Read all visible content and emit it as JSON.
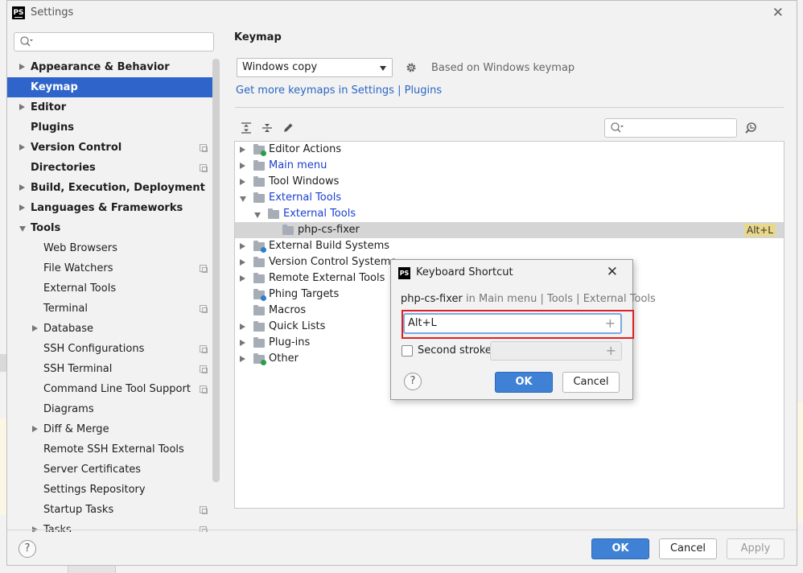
{
  "window": {
    "title": "Settings",
    "logo": "PS"
  },
  "sidebar": {
    "search_placeholder": "",
    "items": [
      {
        "label": "Appearance & Behavior",
        "level": 0,
        "bold": true,
        "arrow": "right",
        "copy": false,
        "selected": false
      },
      {
        "label": "Keymap",
        "level": 0,
        "bold": true,
        "arrow": "",
        "copy": false,
        "selected": true
      },
      {
        "label": "Editor",
        "level": 0,
        "bold": true,
        "arrow": "right",
        "copy": false,
        "selected": false
      },
      {
        "label": "Plugins",
        "level": 0,
        "bold": true,
        "arrow": "",
        "copy": false,
        "selected": false
      },
      {
        "label": "Version Control",
        "level": 0,
        "bold": true,
        "arrow": "right",
        "copy": true,
        "selected": false
      },
      {
        "label": "Directories",
        "level": 0,
        "bold": true,
        "arrow": "",
        "copy": true,
        "selected": false
      },
      {
        "label": "Build, Execution, Deployment",
        "level": 0,
        "bold": true,
        "arrow": "right",
        "copy": false,
        "selected": false
      },
      {
        "label": "Languages & Frameworks",
        "level": 0,
        "bold": true,
        "arrow": "right",
        "copy": false,
        "selected": false
      },
      {
        "label": "Tools",
        "level": 0,
        "bold": true,
        "arrow": "down",
        "copy": false,
        "selected": false
      },
      {
        "label": "Web Browsers",
        "level": 1,
        "bold": false,
        "arrow": "",
        "copy": false,
        "selected": false
      },
      {
        "label": "File Watchers",
        "level": 1,
        "bold": false,
        "arrow": "",
        "copy": true,
        "selected": false
      },
      {
        "label": "External Tools",
        "level": 1,
        "bold": false,
        "arrow": "",
        "copy": false,
        "selected": false
      },
      {
        "label": "Terminal",
        "level": 1,
        "bold": false,
        "arrow": "",
        "copy": true,
        "selected": false
      },
      {
        "label": "Database",
        "level": 1,
        "bold": false,
        "arrow": "right",
        "copy": false,
        "selected": false
      },
      {
        "label": "SSH Configurations",
        "level": 1,
        "bold": false,
        "arrow": "",
        "copy": true,
        "selected": false
      },
      {
        "label": "SSH Terminal",
        "level": 1,
        "bold": false,
        "arrow": "",
        "copy": true,
        "selected": false
      },
      {
        "label": "Command Line Tool Support",
        "level": 1,
        "bold": false,
        "arrow": "",
        "copy": true,
        "selected": false
      },
      {
        "label": "Diagrams",
        "level": 1,
        "bold": false,
        "arrow": "",
        "copy": false,
        "selected": false
      },
      {
        "label": "Diff & Merge",
        "level": 1,
        "bold": false,
        "arrow": "right",
        "copy": false,
        "selected": false
      },
      {
        "label": "Remote SSH External Tools",
        "level": 1,
        "bold": false,
        "arrow": "",
        "copy": false,
        "selected": false
      },
      {
        "label": "Server Certificates",
        "level": 1,
        "bold": false,
        "arrow": "",
        "copy": false,
        "selected": false
      },
      {
        "label": "Settings Repository",
        "level": 1,
        "bold": false,
        "arrow": "",
        "copy": false,
        "selected": false
      },
      {
        "label": "Startup Tasks",
        "level": 1,
        "bold": false,
        "arrow": "",
        "copy": true,
        "selected": false
      },
      {
        "label": "Tasks",
        "level": 1,
        "bold": false,
        "arrow": "right",
        "copy": true,
        "selected": false
      }
    ]
  },
  "content": {
    "title": "Keymap",
    "keymap_select": "Windows copy",
    "based_on": "Based on Windows keymap",
    "get_more_link": "Get more keymaps in Settings | Plugins",
    "tree_search_placeholder": "",
    "tree": [
      {
        "label": "Editor Actions",
        "indent": 0,
        "arrow": "right",
        "color": "normal",
        "badge": "#2d9d4a",
        "shortcut": "",
        "selected": false
      },
      {
        "label": "Main menu",
        "indent": 0,
        "arrow": "right",
        "color": "blue",
        "badge": "",
        "shortcut": "",
        "selected": false
      },
      {
        "label": "Tool Windows",
        "indent": 0,
        "arrow": "right",
        "color": "normal",
        "badge": "",
        "shortcut": "",
        "selected": false
      },
      {
        "label": "External Tools",
        "indent": 0,
        "arrow": "down",
        "color": "blue",
        "badge": "",
        "shortcut": "",
        "selected": false
      },
      {
        "label": "External Tools",
        "indent": 1,
        "arrow": "down",
        "color": "blue",
        "badge": "",
        "shortcut": "",
        "selected": false
      },
      {
        "label": "php-cs-fixer",
        "indent": 2,
        "arrow": "",
        "color": "normal",
        "badge": "",
        "shortcut": "Alt+L",
        "selected": true
      },
      {
        "label": "External Build Systems",
        "indent": 0,
        "arrow": "right",
        "color": "normal",
        "badge": "#2e7fc9",
        "shortcut": "",
        "selected": false
      },
      {
        "label": "Version Control Systems",
        "indent": 0,
        "arrow": "right",
        "color": "normal",
        "badge": "",
        "shortcut": "",
        "selected": false
      },
      {
        "label": "Remote External Tools",
        "indent": 0,
        "arrow": "right",
        "color": "normal",
        "badge": "",
        "shortcut": "",
        "selected": false
      },
      {
        "label": "Phing Targets",
        "indent": 0,
        "arrow": "",
        "color": "normal",
        "badge": "#2e7fc9",
        "shortcut": "",
        "selected": false
      },
      {
        "label": "Macros",
        "indent": 0,
        "arrow": "",
        "color": "normal",
        "badge": "",
        "shortcut": "",
        "selected": false
      },
      {
        "label": "Quick Lists",
        "indent": 0,
        "arrow": "right",
        "color": "normal",
        "badge": "",
        "shortcut": "",
        "selected": false
      },
      {
        "label": "Plug-ins",
        "indent": 0,
        "arrow": "right",
        "color": "normal",
        "badge": "",
        "shortcut": "",
        "selected": false
      },
      {
        "label": "Other",
        "indent": 0,
        "arrow": "right",
        "color": "normal",
        "badge": "#2d9d4a",
        "shortcut": "",
        "selected": false
      }
    ]
  },
  "dialog": {
    "logo": "PS",
    "title": "Keyboard Shortcut",
    "action_name": "php-cs-fixer",
    "path_in": "in Main menu",
    "path_sep1": "|",
    "path_part2": "Tools",
    "path_sep2": "|",
    "path_part3": "External Tools",
    "first_stroke": "Alt+L",
    "second_stroke_label": "Second stroke:",
    "second_stroke_checked": false,
    "ok_label": "OK",
    "cancel_label": "Cancel",
    "help_label": "?"
  },
  "footer": {
    "help_label": "?",
    "ok_label": "OK",
    "cancel_label": "Cancel",
    "apply_label": "Apply"
  },
  "colors": {
    "selection": "#2f65ca",
    "link": "#2a66c5",
    "highlight_border": "#e02020",
    "shortcut_tag": "#e8d98a"
  }
}
